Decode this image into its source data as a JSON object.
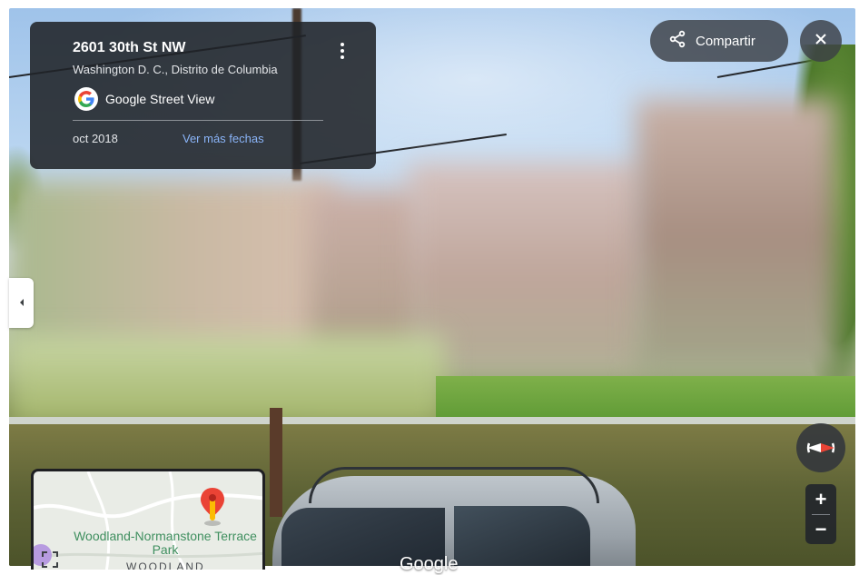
{
  "location": {
    "address": "2601 30th St NW",
    "city": "Washington D. C., Distrito de Columbia"
  },
  "source": {
    "label": "Google Street View"
  },
  "capture": {
    "date": "oct 2018",
    "more_dates_label": "Ver más fechas"
  },
  "toolbar": {
    "share_label": "Compartir"
  },
  "minimap": {
    "park_label": "Woodland-Normanstone Terrace Park",
    "area_label": "WOODLAND"
  },
  "zoom": {
    "in_label": "+",
    "out_label": "−"
  },
  "watermark": "Google",
  "colors": {
    "card_bg": "#202328",
    "link": "#8ab4f8",
    "pin_red": "#ea4335",
    "pin_yellow": "#fbbc04",
    "park_text": "#3f8f5f"
  },
  "icons": [
    "menu-dots-icon",
    "google-logo-icon",
    "share-icon",
    "close-icon",
    "chevron-left-icon",
    "compass-icon",
    "map-pin-icon",
    "expand-icon"
  ]
}
